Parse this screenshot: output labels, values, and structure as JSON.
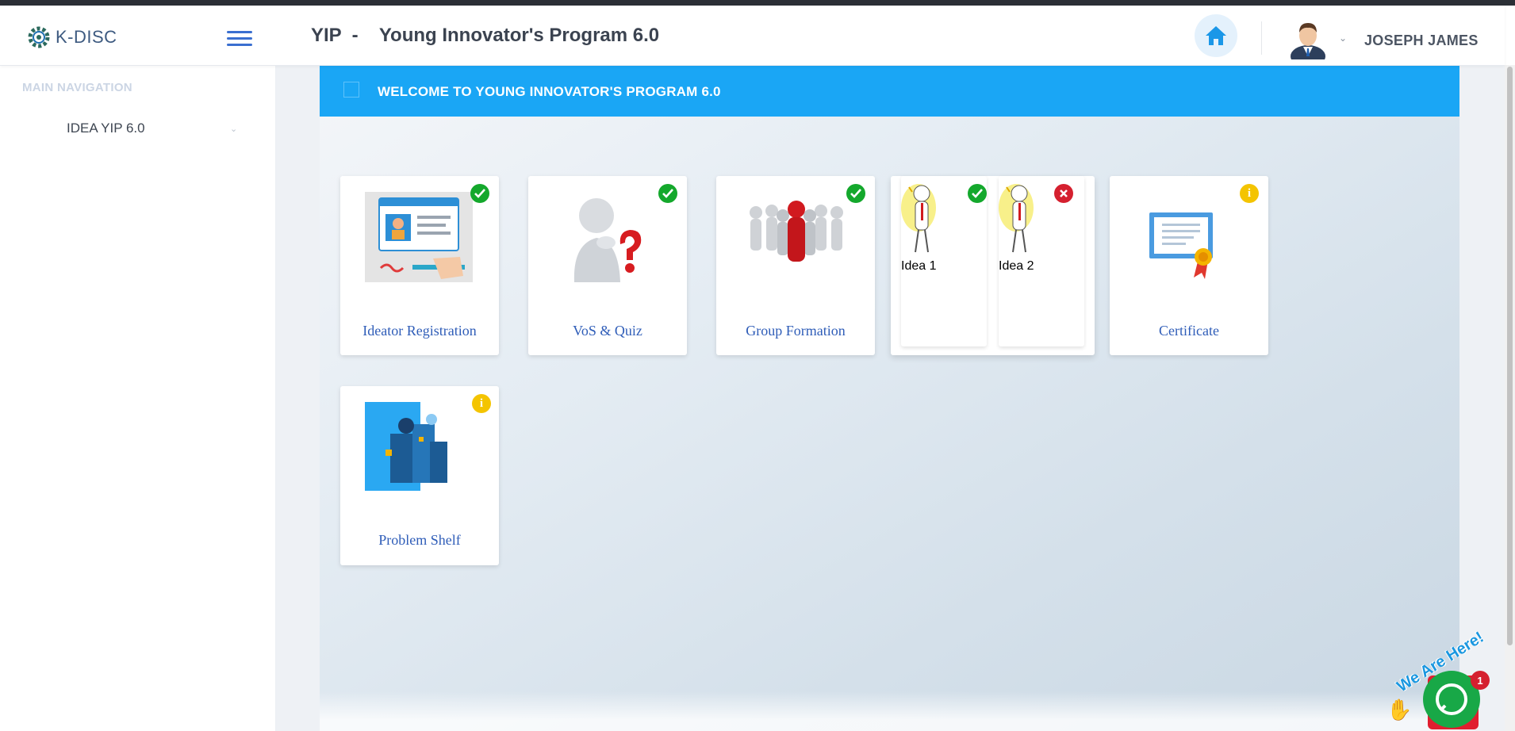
{
  "header": {
    "logo_text": "K-DISC",
    "title": "YIP  -    Young Innovator's Program 6.0",
    "username": "JOSEPH JAMES"
  },
  "sidebar": {
    "heading": "MAIN NAVIGATION",
    "items": [
      {
        "label": "IDEA YIP 6.0"
      }
    ]
  },
  "welcome": {
    "text": "WELCOME TO YOUNG INNOVATOR'S PROGRAM 6.0"
  },
  "cards": [
    {
      "label": "Ideator Registration",
      "status": "complete"
    },
    {
      "label": "VoS & Quiz",
      "status": "complete"
    },
    {
      "label": "Group Formation",
      "status": "complete"
    },
    {
      "label": "Idea 1",
      "status": "complete"
    },
    {
      "label": "Idea 2",
      "status": "rejected"
    },
    {
      "label": "Certificate",
      "status": "info"
    },
    {
      "label": "Problem Shelf",
      "status": "info"
    }
  ],
  "chat": {
    "banner": "We Are Here!",
    "badge_count": "1"
  },
  "colors": {
    "accent": "#1aa6f5",
    "link": "#2f5db8",
    "status_ok": "#14a82c",
    "status_err": "#d5202f",
    "status_info": "#f4c400"
  }
}
